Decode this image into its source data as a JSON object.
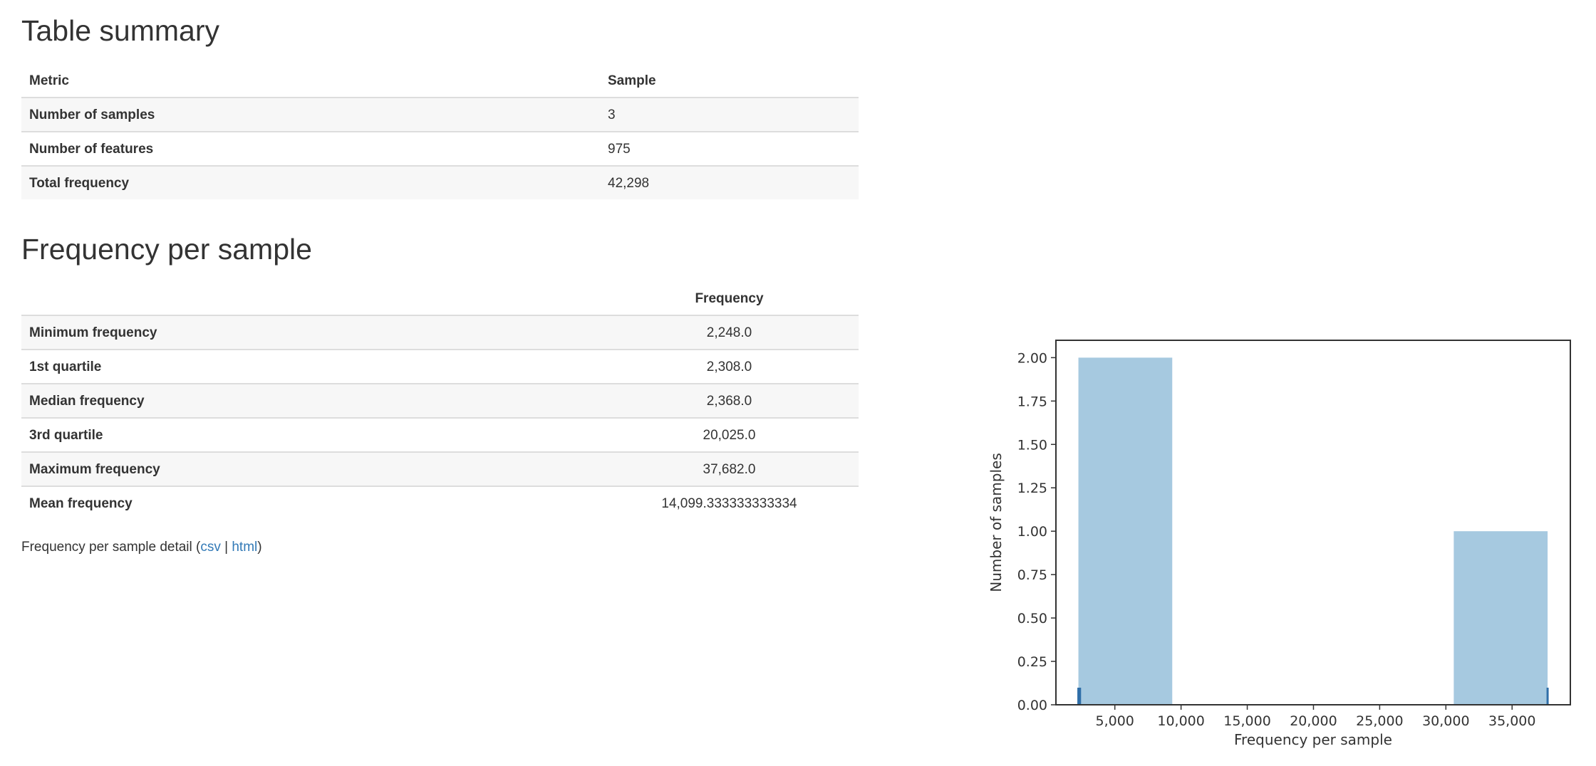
{
  "table_summary": {
    "title": "Table summary",
    "headers": [
      "Metric",
      "Sample"
    ],
    "rows": [
      {
        "metric": "Number of samples",
        "value": "3"
      },
      {
        "metric": "Number of features",
        "value": "975"
      },
      {
        "metric": "Total frequency",
        "value": "42,298"
      }
    ]
  },
  "frequency_per_sample": {
    "title": "Frequency per sample",
    "header": "Frequency",
    "rows": [
      {
        "metric": "Minimum frequency",
        "value": "2,248.0"
      },
      {
        "metric": "1st quartile",
        "value": "2,308.0"
      },
      {
        "metric": "Median frequency",
        "value": "2,368.0"
      },
      {
        "metric": "3rd quartile",
        "value": "20,025.0"
      },
      {
        "metric": "Maximum frequency",
        "value": "37,682.0"
      },
      {
        "metric": "Mean frequency",
        "value": "14,099.333333333334"
      }
    ],
    "detail": {
      "prefix": "Frequency per sample detail (",
      "csv": "csv",
      "separator": " | ",
      "html": "html",
      "suffix": ")"
    }
  },
  "colors": {
    "bar_fill": "#a6c9e0",
    "rug": "#2f6ea8",
    "link": "#337ab7"
  },
  "chart_data": {
    "type": "bar",
    "title": "",
    "xlabel": "Frequency per sample",
    "ylabel": "Number of samples",
    "xlim": [
      550,
      39400
    ],
    "ylim": [
      0,
      2.1
    ],
    "x_ticks": [
      5000,
      10000,
      15000,
      20000,
      25000,
      30000,
      35000
    ],
    "x_tick_labels": [
      "5,000",
      "10,000",
      "15,000",
      "20,000",
      "25,000",
      "30,000",
      "35,000"
    ],
    "y_ticks": [
      0,
      0.25,
      0.5,
      0.75,
      1.0,
      1.25,
      1.5,
      1.75,
      2.0
    ],
    "y_tick_labels": [
      "0.00",
      "0.25",
      "0.50",
      "0.75",
      "1.00",
      "1.25",
      "1.50",
      "1.75",
      "2.00"
    ],
    "bins": [
      {
        "x0": 2248,
        "x1": 9335,
        "count": 2
      },
      {
        "x0": 30595,
        "x1": 37682,
        "count": 1
      }
    ],
    "rug": [
      2248,
      2368,
      37682
    ],
    "grid": false
  }
}
